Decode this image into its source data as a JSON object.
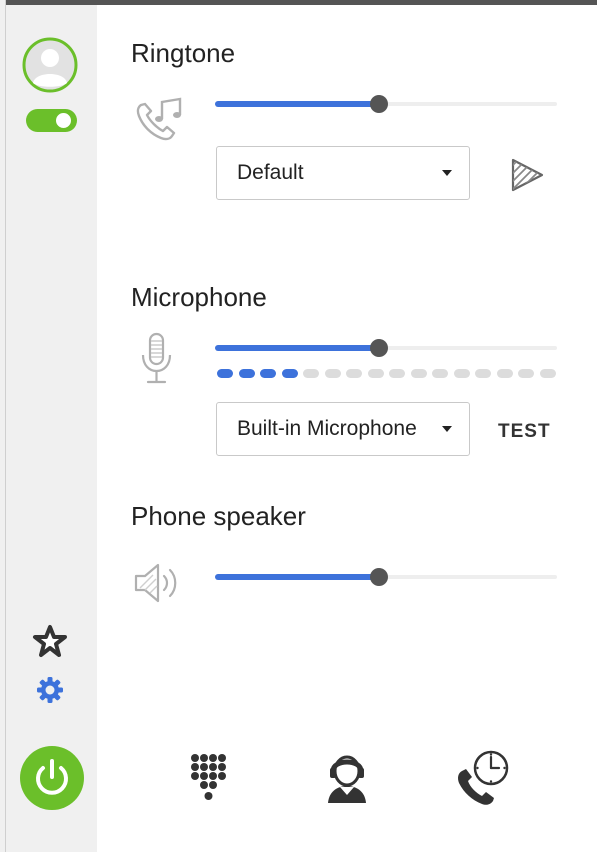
{
  "settings": {
    "ringtone": {
      "title": "Ringtone",
      "volume_percent": 48,
      "selected": "Default",
      "icon": "ringtone-icon",
      "play_icon": "play-icon"
    },
    "microphone": {
      "title": "Microphone",
      "volume_percent": 48,
      "level_active_dots": 4,
      "level_total_dots": 16,
      "selected": "Built-in Microphone",
      "test_label": "TEST",
      "icon": "microphone-icon"
    },
    "speaker": {
      "title": "Phone speaker",
      "volume_percent": 48,
      "icon": "speaker-icon"
    }
  },
  "sidebar": {
    "avatar_icon": "avatar-icon",
    "status_toggle_on": true,
    "favorites_icon": "star-icon",
    "settings_icon": "gear-icon",
    "power_icon": "power-icon"
  },
  "bottom_nav": [
    {
      "id": "dialpad",
      "icon": "dialpad-icon"
    },
    {
      "id": "contacts",
      "icon": "contacts-icon"
    },
    {
      "id": "history",
      "icon": "call-history-icon"
    }
  ],
  "colors": {
    "accent": "#3d72db",
    "green": "#6bbf2a",
    "slider_thumb": "#555555",
    "dot_inactive": "#dcdcdc",
    "sidebar_bg": "#f0f0f0"
  }
}
